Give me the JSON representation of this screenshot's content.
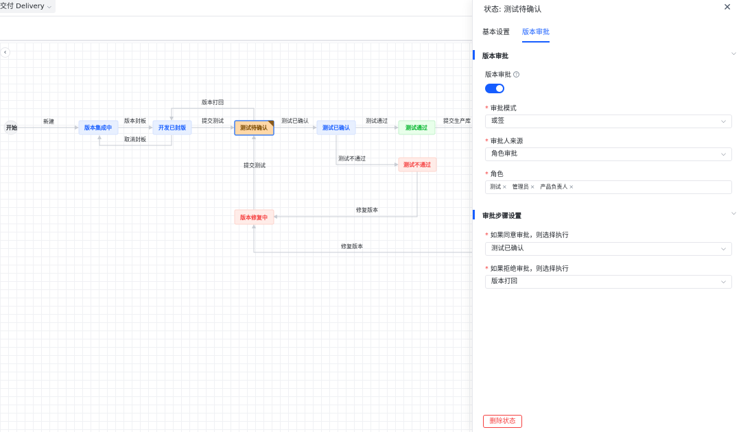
{
  "breadcrumb": {
    "label": "交付 Delivery"
  },
  "flow": {
    "nodes": {
      "start": "开始",
      "integrating": "版本集成中",
      "dev_sealed": "开发已封版",
      "test_pending": "测试待确认",
      "test_confirmed": "测试已确认",
      "test_passed": "测试通过",
      "test_failed": "测试不通过",
      "fixing": "版本修复中"
    },
    "edges": {
      "new": "新建",
      "seal": "版本封板",
      "unseal": "取消封板",
      "reject_back": "版本打回",
      "submit_test": "提交测试",
      "confirm": "测试已确认",
      "pass": "测试通过",
      "to_prod": "提交生产库",
      "fail": "测试不通过",
      "resubmit": "提交测试",
      "fix1": "修复版本",
      "fix2": "修复版本"
    }
  },
  "panel": {
    "title": "状态: 测试待确认",
    "tabs": [
      "基本设置",
      "版本审批"
    ],
    "section1": {
      "title": "版本审批",
      "toggle_label": "版本审批",
      "toggle_on": true,
      "mode_label": "审批模式",
      "mode_value": "或签",
      "source_label": "审批人来源",
      "source_value": "角色审批",
      "role_label": "角色",
      "roles": [
        "测试",
        "管理员",
        "产品负责人"
      ]
    },
    "section2": {
      "title": "审批步骤设置",
      "approve_label": "如果同意审批，则选择执行",
      "approve_value": "测试已确认",
      "reject_label": "如果拒绝审批，则选择执行",
      "reject_value": "版本打回"
    },
    "delete_label": "删除状态"
  },
  "colors": {
    "accent": "#165dff",
    "danger": "#f53f3f",
    "success": "#00b42a",
    "warning": "#ff7d00"
  }
}
